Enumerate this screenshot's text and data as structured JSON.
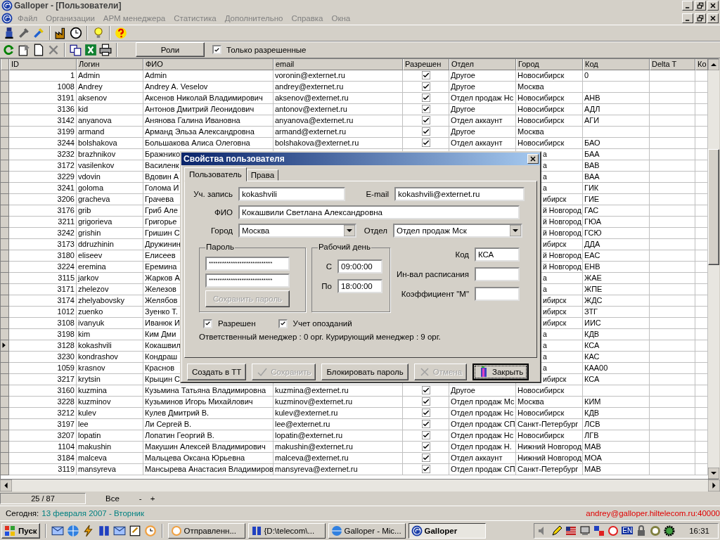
{
  "window": {
    "title": "Galloper - [Пользователи]"
  },
  "menu": [
    "Файл",
    "Организации",
    "АРМ менеджера",
    "Статистика",
    "Дополнительно",
    "Справка",
    "Окна"
  ],
  "toolbar": {
    "roles_button": "Роли",
    "only_allowed": {
      "label": "Только разрешенные",
      "checked": true
    }
  },
  "table": {
    "columns": [
      "ID",
      "Логин",
      "ФИО",
      "email",
      "Разрешен",
      "Отдел",
      "Город",
      "Код",
      "Delta T",
      "Ко"
    ],
    "rows": [
      {
        "kind": "full",
        "selected": false,
        "id": "1",
        "login": "Admin",
        "fio": "Admin",
        "email": "voronin@externet.ru",
        "allowed": true,
        "dept": "Другое",
        "city": "Новосибирск",
        "code": "0"
      },
      {
        "kind": "full",
        "selected": false,
        "id": "1008",
        "login": "Andrey",
        "fio": "Andrey A. Veselov",
        "email": "andrey@externet.ru",
        "allowed": true,
        "dept": "Другое",
        "city": "Москва"
      },
      {
        "kind": "full",
        "selected": false,
        "id": "3191",
        "login": "aksenov",
        "fio": "Аксенов Николай Владимирович",
        "email": "aksenov@externet.ru",
        "allowed": true,
        "dept": "Отдел продаж Нс",
        "city": "Новосибирск",
        "code": "АНВ"
      },
      {
        "kind": "full",
        "selected": false,
        "id": "3136",
        "login": "kid",
        "fio": "Антонов Дмитрий Леонидович",
        "email": "antonov@externet.ru",
        "allowed": true,
        "dept": "Другое",
        "city": "Новосибирск",
        "code": "АДЛ"
      },
      {
        "kind": "full",
        "selected": false,
        "id": "3142",
        "login": "anyanova",
        "fio": "Анянова Галина Ивановна",
        "email": "anyanova@externet.ru",
        "allowed": true,
        "dept": "Отдел аккаунт",
        "city": "Новосибирск",
        "code": "АГИ"
      },
      {
        "kind": "full",
        "selected": false,
        "id": "3199",
        "login": "armand",
        "fio": "Арманд Эльза Александровна",
        "email": "armand@externet.ru",
        "allowed": true,
        "dept": "Другое",
        "city": "Москва"
      },
      {
        "kind": "full",
        "selected": false,
        "id": "3244",
        "login": "bolshakova",
        "fio": "Большакова Алиса Олеговна",
        "email": "bolshakova@externet.ru",
        "allowed": true,
        "dept": "Отдел аккаунт",
        "city": "Новосибирск",
        "code": "БАО"
      },
      {
        "kind": "covered",
        "selected": false,
        "id": "3232",
        "login": "brazhnikov",
        "fio": "Бражнико",
        "city": "а",
        "code": "БАА"
      },
      {
        "kind": "covered",
        "selected": false,
        "id": "3172",
        "login": "vasilenkov",
        "fio": "Василенк",
        "city": "а",
        "code": "ВАВ"
      },
      {
        "kind": "covered",
        "selected": false,
        "id": "3229",
        "login": "vdovin",
        "fio": "Вдовин А",
        "city": "а",
        "code": "ВАА"
      },
      {
        "kind": "covered",
        "selected": false,
        "id": "3241",
        "login": "goloma",
        "fio": "Голома И",
        "city": "а",
        "code": "ГИК"
      },
      {
        "kind": "covered",
        "selected": false,
        "id": "3206",
        "login": "gracheva",
        "fio": "Грачева",
        "city": "ибирск",
        "code": "ГИЕ"
      },
      {
        "kind": "covered",
        "selected": false,
        "id": "3176",
        "login": "grib",
        "fio": "Гриб Але",
        "city": "й Новгород",
        "code": "ГАС"
      },
      {
        "kind": "covered",
        "selected": false,
        "id": "3211",
        "login": "grigorieva",
        "fio": "Григорье",
        "city": "й Новгород",
        "code": "ГЮА"
      },
      {
        "kind": "covered",
        "selected": false,
        "id": "3242",
        "login": "grishin",
        "fio": "Гришин С",
        "city": "й Новгород",
        "code": "ГСЮ"
      },
      {
        "kind": "covered",
        "selected": false,
        "id": "3173",
        "login": "ddruzhinin",
        "fio": "Дружинин",
        "city": "ибирск",
        "code": "ДДА"
      },
      {
        "kind": "covered",
        "selected": false,
        "id": "3180",
        "login": "eliseev",
        "fio": "Елисеев",
        "city": "й Новгород",
        "code": "ЕАС"
      },
      {
        "kind": "covered",
        "selected": false,
        "id": "3224",
        "login": "eremina",
        "fio": "Еремина",
        "city": "й Новгород",
        "code": "ЕНВ"
      },
      {
        "kind": "covered",
        "selected": false,
        "id": "3115",
        "login": "jarkov",
        "fio": "Жарков А",
        "city": "а",
        "code": "ЖАЕ"
      },
      {
        "kind": "covered",
        "selected": false,
        "id": "3171",
        "login": "zhelezov",
        "fio": "Железов",
        "city": "а",
        "code": "ЖПЕ"
      },
      {
        "kind": "covered",
        "selected": false,
        "id": "3174",
        "login": "zhelyabovsky",
        "fio": "Желябов",
        "city": "ибирск",
        "code": "ЖДС"
      },
      {
        "kind": "covered",
        "selected": false,
        "id": "1012",
        "login": "zuenko",
        "fio": "Зуенко Т.",
        "city": "ибирск",
        "code": "ЗТГ"
      },
      {
        "kind": "covered",
        "selected": false,
        "id": "3108",
        "login": "ivanyuk",
        "fio": "Иванюк И",
        "city": "ибирск",
        "code": "ИИС"
      },
      {
        "kind": "covered",
        "selected": false,
        "id": "3198",
        "login": "kim",
        "fio": "Ким Дми",
        "city": "а",
        "code": "КДВ"
      },
      {
        "kind": "covered",
        "selected": true,
        "id": "3128",
        "login": "kokashvili",
        "fio": "Кокашвил",
        "city": "а",
        "code": "КСА"
      },
      {
        "kind": "covered",
        "selected": false,
        "id": "3230",
        "login": "kondrashov",
        "fio": "Кондраш",
        "city": "а",
        "code": "КАС"
      },
      {
        "kind": "covered",
        "selected": false,
        "id": "1059",
        "login": "krasnov",
        "fio": "Краснов",
        "city": "а",
        "code": "КАА00"
      },
      {
        "kind": "covered",
        "selected": false,
        "id": "3217",
        "login": "krytsin",
        "fio": "Крыцин С",
        "city": "ибирск",
        "code": "КСА"
      },
      {
        "kind": "full",
        "selected": false,
        "id": "3160",
        "login": "kuzmina",
        "fio": "Кузьмина Татьяна Владимировна",
        "email": "kuzmina@externet.ru",
        "allowed": true,
        "dept": "Другое",
        "city": "Новосибирск"
      },
      {
        "kind": "full",
        "selected": false,
        "id": "3228",
        "login": "kuzminov",
        "fio": "Кузьминов Игорь Михайлович",
        "email": "kuzminov@externet.ru",
        "allowed": true,
        "dept": "Отдел продаж Мс",
        "city": "Москва",
        "code": "КИМ"
      },
      {
        "kind": "full",
        "selected": false,
        "id": "3212",
        "login": "kulev",
        "fio": "Кулев Дмитрий В.",
        "email": "kulev@externet.ru",
        "allowed": true,
        "dept": "Отдел продаж Нс",
        "city": "Новосибирск",
        "code": "КДВ"
      },
      {
        "kind": "full",
        "selected": false,
        "id": "3197",
        "login": "lee",
        "fio": "Ли Сергей В.",
        "email": "lee@externet.ru",
        "allowed": true,
        "dept": "Отдел продаж СП",
        "city": "Санкт-Петербург",
        "code": "ЛСВ"
      },
      {
        "kind": "full",
        "selected": false,
        "id": "3207",
        "login": "lopatin",
        "fio": "Лопатин Георгий В.",
        "email": "lopatin@externet.ru",
        "allowed": true,
        "dept": "Отдел продаж Нс",
        "city": "Новосибирск",
        "code": "ЛГВ"
      },
      {
        "kind": "full",
        "selected": false,
        "id": "1104",
        "login": "makushin",
        "fio": "Макушин Алексей Владимирович",
        "email": "makushin@externet.ru",
        "allowed": true,
        "dept": "Отдел продаж Н.",
        "city": "Нижний Новгород",
        "code": "МАВ"
      },
      {
        "kind": "full",
        "selected": false,
        "id": "3184",
        "login": "malceva",
        "fio": "Мальцева Оксана Юрьевна",
        "email": "malceva@externet.ru",
        "allowed": true,
        "dept": "Отдел аккаунт",
        "city": "Нижний Новгород",
        "code": "МОА"
      },
      {
        "kind": "full",
        "selected": false,
        "id": "3119",
        "login": "mansyreva",
        "fio": "Мансырева Анастасия Владимиров",
        "email": "mansyreva@externet.ru",
        "allowed": true,
        "dept": "Отдел продаж СП",
        "city": "Санкт-Петербург",
        "code": "МАВ"
      }
    ]
  },
  "dialog": {
    "title": "Свойства пользователя",
    "tabs": [
      {
        "label": "Пользователь",
        "selected": true
      },
      {
        "label": "Права",
        "selected": false
      }
    ],
    "account": {
      "label": "Уч. запись",
      "value": "kokashvili"
    },
    "email": {
      "label": "E-mail",
      "value": "kokashvili@externet.ru"
    },
    "fio": {
      "label": "ФИО",
      "value": "Кокашвили Светлана Александровна"
    },
    "city": {
      "label": "Город",
      "value": "Москва"
    },
    "department": {
      "label": "Отдел",
      "value": "Отдел продаж Мск"
    },
    "password": {
      "label": "Пароль",
      "values": [
        "*****************************",
        "*****************************"
      ],
      "button": {
        "label": "Сохранить пароль",
        "disabled": true
      }
    },
    "workday": {
      "label": "Рабочий день",
      "from": {
        "label": "С",
        "value": "09:00:00"
      },
      "to": {
        "label": "По",
        "value": "18:00:00"
      }
    },
    "code": {
      "label": "Код",
      "value": "КСА"
    },
    "interval": {
      "label": "Ин-вал расписания"
    },
    "coefficient": {
      "label": "Коэффициент \"M\""
    },
    "checks": [
      {
        "label": "Разрешен",
        "checked": true
      },
      {
        "label": "Учет опозданий",
        "checked": true
      }
    ],
    "info": "Ответственный менеджер : 0 орг. Курирующий менеджер : 9 орг.",
    "buttons": [
      {
        "kind": "plain",
        "label": "Создать в ТТ",
        "disabled": false,
        "focused": false
      },
      {
        "kind": "check",
        "label": "Сохранить",
        "disabled": true,
        "focused": false
      },
      {
        "kind": "plain",
        "label": "Блокировать пароль",
        "disabled": false,
        "focused": false
      },
      {
        "kind": "cancel",
        "label": "Отмена",
        "disabled": true,
        "focused": false
      },
      {
        "kind": "door",
        "label": "Закрыть",
        "disabled": false,
        "focused": true
      }
    ]
  },
  "navigator": {
    "position": "25 / 87",
    "filter": "Все",
    "minus": "-",
    "plus": "+"
  },
  "status_bar": {
    "today_label": "Сегодня:",
    "date": "13 февраля 2007 - Вторник",
    "connection": "andrey@galloper.hiltelecom.ru:40000"
  },
  "taskbar": {
    "start": "Пуск",
    "tasks": [
      {
        "label": "Отправленн...",
        "selected": false
      },
      {
        "label": "{D:\\telecom\\...",
        "selected": false
      },
      {
        "label": "Galloper - Mic...",
        "selected": false
      },
      {
        "label": "Galloper",
        "selected": true
      }
    ],
    "language": "EN",
    "clock": "16:31"
  }
}
